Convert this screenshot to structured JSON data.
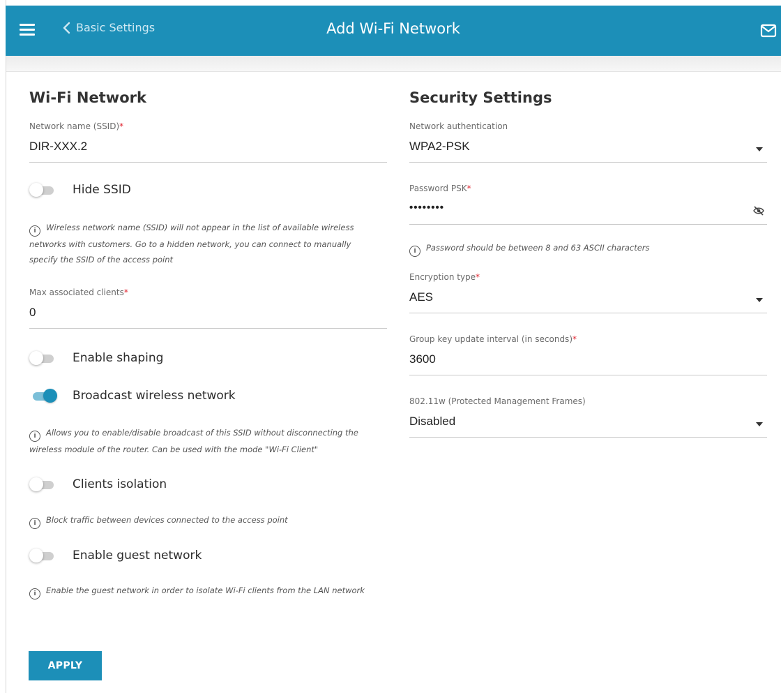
{
  "header": {
    "back_label": "Basic Settings",
    "title": "Add Wi-Fi Network",
    "color": "#1c8fb8"
  },
  "wifi": {
    "title": "Wi-Fi Network",
    "ssid_label": "Network name (SSID)",
    "ssid_value": "DIR-XXX.2",
    "hide_ssid": {
      "label": "Hide SSID",
      "on": false
    },
    "hide_ssid_hint": [
      "Wireless network name (SSID) will not appear in the list of available wireless",
      "networks with customers. Go to a hidden network, you can connect to manually",
      "specify the SSID of the access point"
    ],
    "max_clients_label": "Max associated clients",
    "max_clients_value": "0",
    "enable_shaping": {
      "label": "Enable shaping",
      "on": false
    },
    "broadcast": {
      "label": "Broadcast wireless network",
      "on": true
    },
    "broadcast_hint": [
      "Allows you to enable/disable broadcast of this SSID without disconnecting the",
      "wireless module of the router. Can be used with the mode \"Wi-Fi Client\""
    ],
    "clients_isolation": {
      "label": "Clients isolation",
      "on": false
    },
    "isolation_hint": "Block traffic between devices connected to the access point",
    "guest_network": {
      "label": "Enable guest network",
      "on": false
    },
    "guest_hint": "Enable the guest network in order to isolate Wi-Fi clients from the LAN network"
  },
  "security": {
    "title": "Security Settings",
    "auth_label": "Network authentication",
    "auth_value": "WPA2-PSK",
    "psk_label": "Password PSK",
    "psk_value": "••••••••",
    "psk_hint": "Password should be between 8 and 63 ASCII characters",
    "enc_label": "Encryption type",
    "enc_value": "AES",
    "gkui_label": "Group key update interval (in seconds)",
    "gkui_value": "3600",
    "pmf_label": "802.11w (Protected Management Frames)",
    "pmf_value": "Disabled"
  },
  "apply_label": "APPLY",
  "required_mark": "*",
  "info_glyph": "i",
  "icons": [
    "menu-icon",
    "chevron-left-icon",
    "mail-icon",
    "eye-off-icon",
    "info-icon",
    "caret-down-icon"
  ]
}
